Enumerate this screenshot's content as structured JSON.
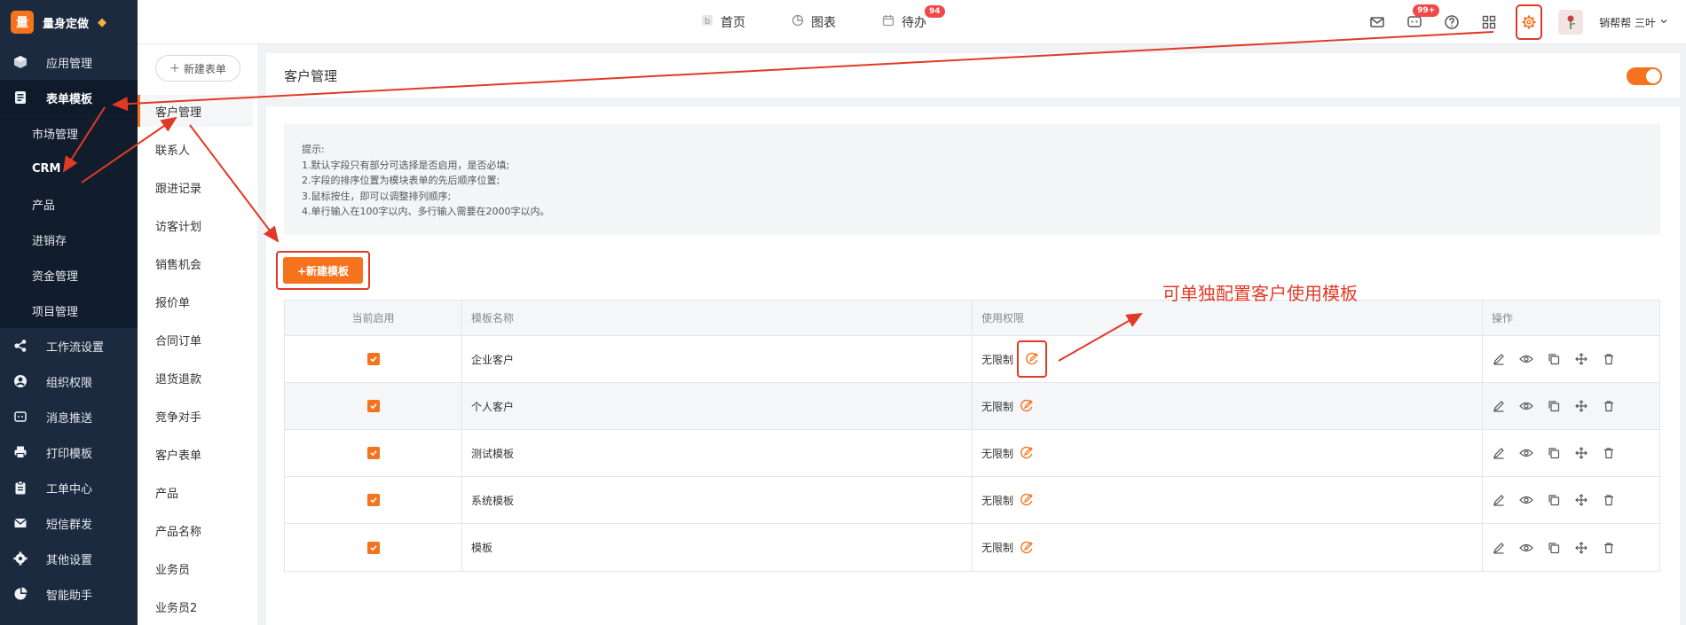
{
  "brand": {
    "logo_char": "量",
    "name": "量身定做"
  },
  "sidebar": {
    "items": [
      {
        "label": "应用管理",
        "icon": "cube-icon"
      },
      {
        "label": "表单模板",
        "icon": "form-icon",
        "active": true
      },
      {
        "label": "工作流设置",
        "icon": "workflow-icon"
      },
      {
        "label": "组织权限",
        "icon": "user-circle-icon"
      },
      {
        "label": "消息推送",
        "icon": "message-icon"
      },
      {
        "label": "打印模板",
        "icon": "printer-icon"
      },
      {
        "label": "工单中心",
        "icon": "clipboard-icon"
      },
      {
        "label": "短信群发",
        "icon": "mail-icon"
      },
      {
        "label": "其他设置",
        "icon": "gear-icon"
      },
      {
        "label": "智能助手",
        "icon": "pie-icon"
      }
    ],
    "subitems": [
      "市场管理",
      "CRM",
      "产品",
      "进销存",
      "资金管理",
      "项目管理"
    ]
  },
  "topnav": {
    "home": "首页",
    "charts": "图表",
    "todo": "待办",
    "todo_badge": "94"
  },
  "topright": {
    "msg_badge": "99+",
    "user": "销帮帮 三叶"
  },
  "subpanel": {
    "new_form": "新建表单",
    "items": [
      "客户管理",
      "联系人",
      "跟进记录",
      "访客计划",
      "销售机会",
      "报价单",
      "合同订单",
      "退货退款",
      "竞争对手",
      "客户表单",
      "产品",
      "产品名称",
      "业务员",
      "业务员2"
    ]
  },
  "content": {
    "title": "客户管理",
    "tips": {
      "heading": "提示:",
      "lines": [
        "1.默认字段只有部分可选择是否启用，是否必填;",
        "2.字段的排序位置为模块表单的先后顺序位置;",
        "3.鼠标按住，即可以调整排列顺序;",
        "4.单行输入在100字以内、多行输入需要在2000字以内。"
      ]
    },
    "new_template": "+新建模板",
    "annotation": "可单独配置客户使用模板"
  },
  "table": {
    "headers": [
      "当前启用",
      "模板名称",
      "使用权限",
      "操作"
    ],
    "rows": [
      {
        "name": "企业客户",
        "perm": "无限制"
      },
      {
        "name": "个人客户",
        "perm": "无限制"
      },
      {
        "name": "测试模板",
        "perm": "无限制"
      },
      {
        "name": "系统模板",
        "perm": "无限制"
      },
      {
        "name": "模板",
        "perm": "无限制"
      }
    ]
  },
  "colors": {
    "accent": "#f5731d",
    "sidebar": "#1c2a3f",
    "annotation": "#e03a26"
  }
}
